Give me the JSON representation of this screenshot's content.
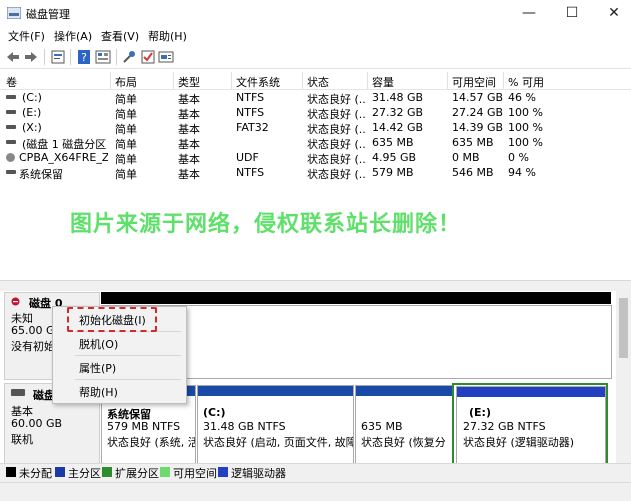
{
  "window": {
    "title": "磁盘管理",
    "minimize_glyph": "—",
    "maximize_glyph": "☐",
    "close_glyph": "✕"
  },
  "menu": [
    "文件(F)",
    "操作(A)",
    "查看(V)",
    "帮助(H)"
  ],
  "toolbar_icons": [
    "back-icon",
    "forward-icon",
    "properties-icon",
    "help-icon",
    "list-view-icon",
    "connect-icon",
    "check-icon",
    "settings-icon"
  ],
  "table": {
    "columns": [
      "卷",
      "布局",
      "类型",
      "文件系统",
      "状态",
      "容量",
      "可用空间",
      "% 可用"
    ],
    "rows": [
      [
        "(C:)",
        "简单",
        "基本",
        "NTFS",
        "状态良好 (...",
        "31.48 GB",
        "14.57 GB",
        "46 %"
      ],
      [
        "(E:)",
        "简单",
        "基本",
        "NTFS",
        "状态良好 (...",
        "27.32 GB",
        "27.24 GB",
        "100 %"
      ],
      [
        "(X:)",
        "简单",
        "基本",
        "FAT32",
        "状态良好 (...",
        "14.42 GB",
        "14.39 GB",
        "100 %"
      ],
      [
        "(磁盘 1 磁盘分区 3)",
        "简单",
        "基本",
        "",
        "状态良好 (...",
        "635 MB",
        "635 MB",
        "100 %"
      ],
      [
        "CPBA_X64FRE_Z...",
        "简单",
        "基本",
        "UDF",
        "状态良好 (...",
        "4.95 GB",
        "0 MB",
        "0 %"
      ],
      [
        "系统保留",
        "简单",
        "基本",
        "NTFS",
        "状态良好 (...",
        "579 MB",
        "546 MB",
        "94 %"
      ]
    ]
  },
  "watermark": "图片来源于网络，侵权联系站长删除！",
  "disk0": {
    "name": "磁盘 0",
    "type": "未知",
    "size": "65.00 GB",
    "status": "没有初始"
  },
  "disk1": {
    "name": "磁盘",
    "type": "基本",
    "size": "60.00 GB",
    "status": "联机"
  },
  "partitions": [
    {
      "name": "系统保留",
      "size": "579 MB NTFS",
      "status": "状态良好 (系统, 活"
    },
    {
      "name": "(C:)",
      "size": "31.48 GB NTFS",
      "status": "状态良好 (启动, 页面文件, 故障转"
    },
    {
      "name": "",
      "size": "635 MB",
      "status": "状态良好 (恢复分"
    },
    {
      "name": "(E:)",
      "size": "27.32 GB NTFS",
      "status": "状态良好 (逻辑驱动器)"
    }
  ],
  "context_menu": [
    "初始化磁盘(I)",
    "脱机(O)",
    "属性(P)",
    "帮助(H)"
  ],
  "legend": [
    {
      "label": "未分配",
      "color": "#000000"
    },
    {
      "label": "主分区",
      "color": "#1a3aa8"
    },
    {
      "label": "扩展分区",
      "color": "#2e8b2e"
    },
    {
      "label": "可用空间",
      "color": "#6fd86f"
    },
    {
      "label": "逻辑驱动器",
      "color": "#2340c0"
    }
  ],
  "colors": {
    "primary_partition": "#1a4aa8",
    "highlight_border": "#d42a2a",
    "watermark": "#5fe06a"
  }
}
